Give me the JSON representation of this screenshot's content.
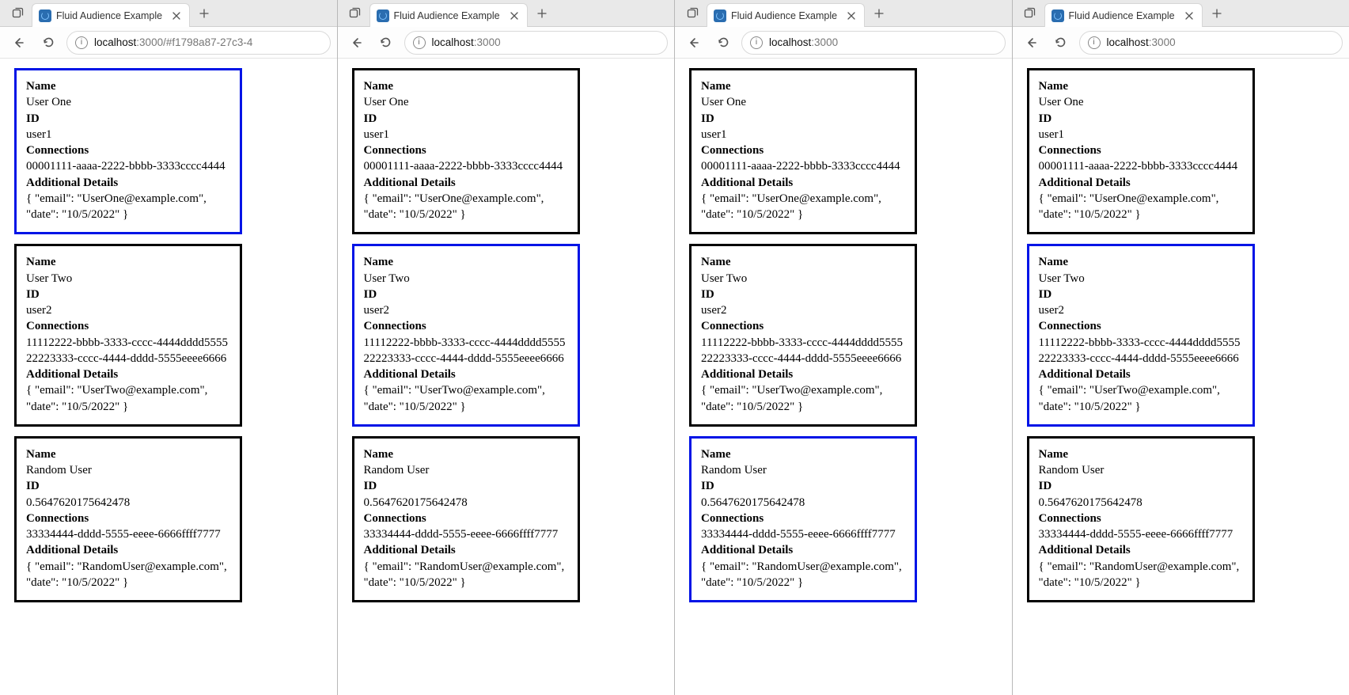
{
  "windows": [
    {
      "tab_title": "Fluid Audience Example",
      "url_host": "localhost",
      "url_rest": ":3000/#f1798a87-27c3-4",
      "selected_index": 0
    },
    {
      "tab_title": "Fluid Audience Example",
      "url_host": "localhost",
      "url_rest": ":3000",
      "selected_index": 1
    },
    {
      "tab_title": "Fluid Audience Example",
      "url_host": "localhost",
      "url_rest": ":3000",
      "selected_index": 2
    },
    {
      "tab_title": "Fluid Audience Example",
      "url_host": "localhost",
      "url_rest": ":3000",
      "selected_index": 1
    }
  ],
  "labels": {
    "name": "Name",
    "id": "ID",
    "connections": "Connections",
    "details": "Additional Details"
  },
  "cards": [
    {
      "name": "User One",
      "id": "user1",
      "connections": [
        "00001111-aaaa-2222-bbbb-3333cccc4444"
      ],
      "details": "{ \"email\": \"UserOne@example.com\", \"date\": \"10/5/2022\" }"
    },
    {
      "name": "User Two",
      "id": "user2",
      "connections": [
        "11112222-bbbb-3333-cccc-4444dddd5555",
        "22223333-cccc-4444-dddd-5555eeee6666"
      ],
      "details": "{ \"email\": \"UserTwo@example.com\", \"date\": \"10/5/2022\" }"
    },
    {
      "name": "Random User",
      "id": "0.5647620175642478",
      "connections": [
        "33334444-dddd-5555-eeee-6666ffff7777"
      ],
      "details": "{ \"email\": \"RandomUser@example.com\", \"date\": \"10/5/2022\" }"
    }
  ]
}
